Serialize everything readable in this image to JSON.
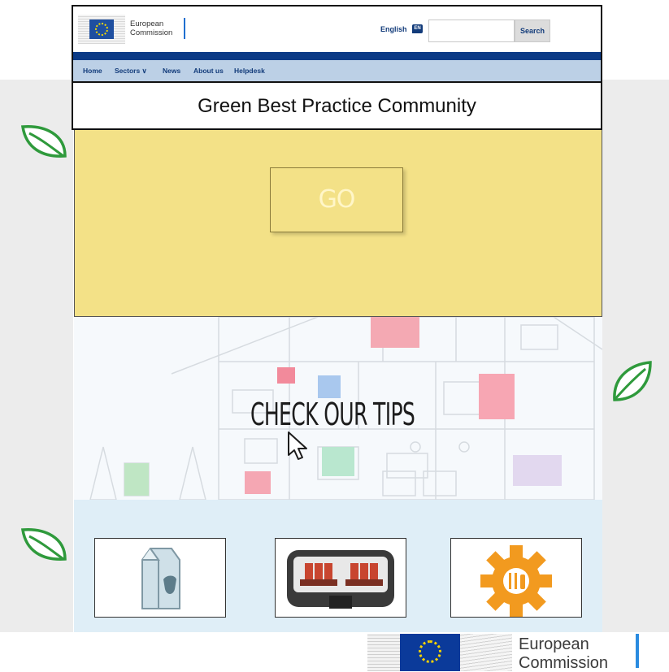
{
  "header": {
    "logo_line1": "European",
    "logo_line2": "Commission",
    "language": "English",
    "language_badge": "EN",
    "search_placeholder": "",
    "search_button": "Search"
  },
  "nav": {
    "items": [
      "Home",
      "Sectors ∨",
      "News",
      "About us",
      "Helpdesk"
    ]
  },
  "page": {
    "title": "Green Best Practice Community",
    "go_button": "GO",
    "tips_heading": "CHECK OUR TIPS"
  },
  "footer_logo": {
    "line1": "European",
    "line2": "Commission"
  },
  "colors": {
    "ec_blue": "#0b3a86",
    "nav_blue": "#bcd0e6",
    "slide_yellow": "#f3e187",
    "leaf_green": "#2f9a3c",
    "gear_orange": "#f29a1f"
  }
}
